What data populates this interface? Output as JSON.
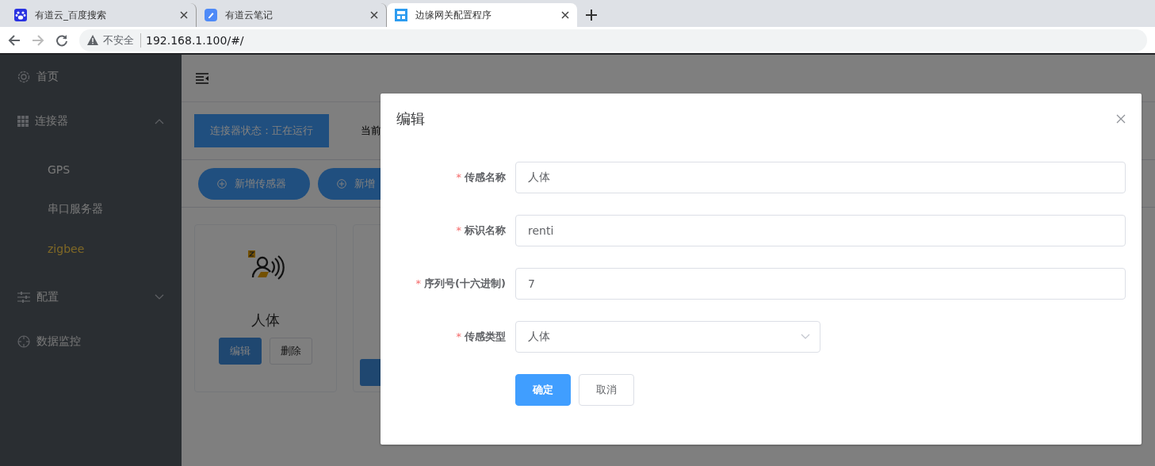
{
  "browser": {
    "tabs": [
      {
        "title": "有道云_百度搜索",
        "selected": false
      },
      {
        "title": "有道云笔记",
        "selected": false
      },
      {
        "title": "边缘网关配置程序",
        "selected": true
      }
    ],
    "address": {
      "security": "不安全",
      "url": "192.168.1.100/#/"
    }
  },
  "sidebar": {
    "items": [
      {
        "label": "首页"
      },
      {
        "label": "连接器",
        "expanded": true,
        "children": [
          {
            "label": "GPS",
            "selected": false
          },
          {
            "label": "串口服务器",
            "selected": false
          },
          {
            "label": "zigbee",
            "selected": true
          }
        ]
      },
      {
        "label": "配置",
        "expanded": false
      },
      {
        "label": "数据监控"
      }
    ]
  },
  "status": {
    "label": "连接器状态：正在运行",
    "current": "当前"
  },
  "toolbar": {
    "buttons": [
      "新增传感器",
      "新增"
    ]
  },
  "cards": [
    {
      "kind": "sensor",
      "name": "人体",
      "actions": [
        {
          "label": "编辑",
          "primary": true
        },
        {
          "label": "删除",
          "primary": false
        }
      ]
    },
    {
      "kind": "covered"
    }
  ],
  "dialog": {
    "title": "编辑",
    "required_mark": "*",
    "fields": [
      {
        "kind": "input",
        "label": "传感名称",
        "required": true,
        "value": "人体"
      },
      {
        "kind": "input",
        "label": "标识名称",
        "required": true,
        "value": "renti"
      },
      {
        "kind": "input",
        "label": "序列号(十六进制)",
        "required": true,
        "value": "7"
      },
      {
        "kind": "select",
        "label": "传感类型",
        "required": true,
        "value": "人体"
      }
    ],
    "buttons": [
      {
        "label": "确定",
        "primary": true
      },
      {
        "label": "取消",
        "primary": false
      }
    ]
  }
}
